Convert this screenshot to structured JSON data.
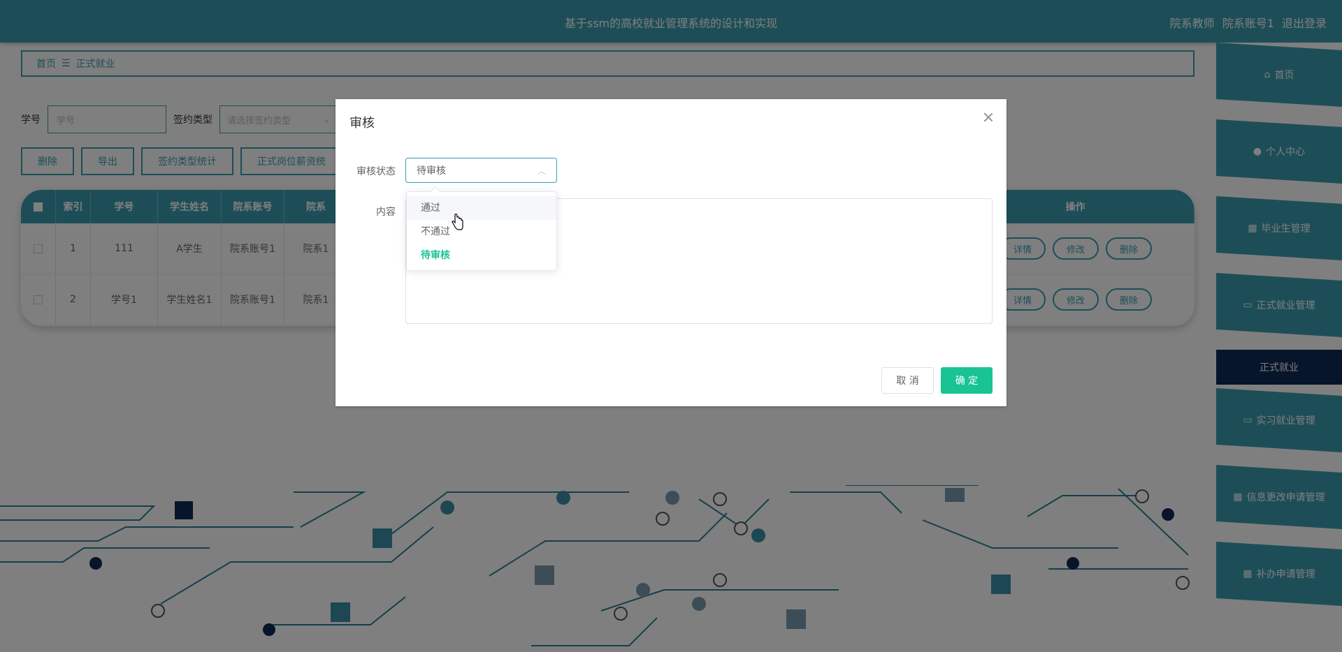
{
  "header": {
    "title": "基于ssm的高校就业管理系统的设计和实现",
    "role": "院系教师",
    "account": "院系账号1",
    "logout": "退出登录"
  },
  "breadcrumb": {
    "home": "首页",
    "separator": "☰",
    "current": "正式就业"
  },
  "search": {
    "sno_label": "学号",
    "sno_placeholder": "学号",
    "type_label": "签约类型",
    "type_placeholder": "请选择签约类型"
  },
  "actions": [
    "删除",
    "导出",
    "签约类型统计",
    "正式岗位薪资统"
  ],
  "table": {
    "columns": [
      "索引",
      "学号",
      "学生姓名",
      "院系账号",
      "院系",
      "操作"
    ],
    "rows": [
      {
        "index": "1",
        "sno": "111",
        "name": "A学生",
        "dept_account": "院系账号1",
        "dept": "院系1"
      },
      {
        "index": "2",
        "sno": "学号1",
        "name": "学生姓名1",
        "dept_account": "院系账号1",
        "dept": "院系1"
      }
    ],
    "row_buttons": {
      "detail": "详情",
      "edit": "修改",
      "delete": "删除"
    }
  },
  "sidebar": {
    "items": [
      {
        "label": "首页",
        "icon": "home-icon"
      },
      {
        "label": "个人中心",
        "icon": "user-icon"
      },
      {
        "label": "毕业生管理",
        "icon": "grid-icon"
      },
      {
        "label": "正式就业管理",
        "icon": "monitor-icon"
      },
      {
        "label": "正式就业",
        "icon": "",
        "active": true
      },
      {
        "label": "实习就业管理",
        "icon": "monitor-icon"
      },
      {
        "label": "信息更改申请管理",
        "icon": "grid-icon"
      },
      {
        "label": "补办申请管理",
        "icon": "grid-icon"
      }
    ]
  },
  "modal": {
    "title": "审核",
    "status_label": "审核状态",
    "status_value": "待审核",
    "content_label": "内容",
    "cancel": "取 消",
    "confirm": "确 定",
    "options": [
      "通过",
      "不通过",
      "待审核"
    ],
    "hovered_option": "通过",
    "selected_option": "待审核"
  },
  "colors": {
    "primary": "#3a9db0",
    "accent": "#19c394",
    "active_sidebar": "#0f2a55"
  }
}
